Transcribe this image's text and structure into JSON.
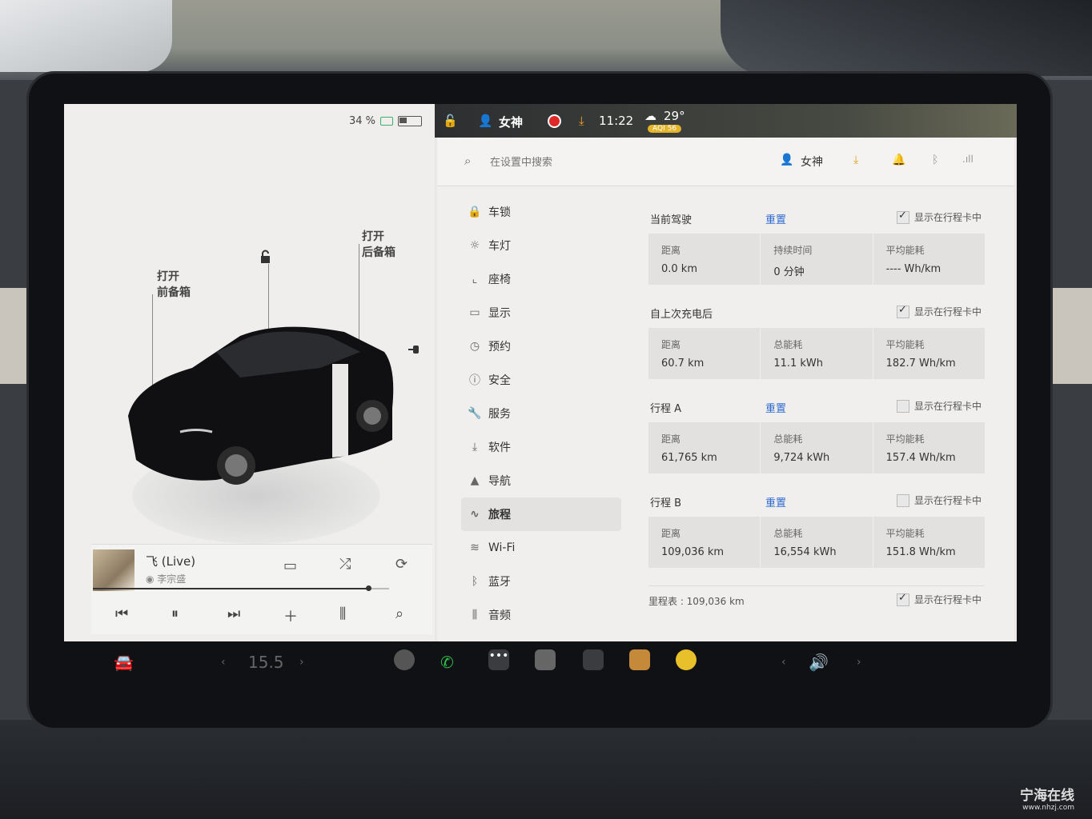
{
  "status_bar": {
    "battery_percent": "34 %",
    "user": "女神",
    "time": "11:22",
    "temperature": "29°",
    "aqi": "AQI 56"
  },
  "vehicle": {
    "frunk_label_line1": "打开",
    "frunk_label_line2": "前备箱",
    "trunk_label_line1": "打开",
    "trunk_label_line2": "后备箱"
  },
  "media": {
    "title": "飞 (Live)",
    "artist": "李宗盛",
    "progress": 0.93
  },
  "settings": {
    "search_placeholder": "在设置中搜索",
    "header_user": "女神",
    "nav": [
      {
        "label": "车锁",
        "icon": "lock-icon"
      },
      {
        "label": "车灯",
        "icon": "light-icon"
      },
      {
        "label": "座椅",
        "icon": "seat-icon"
      },
      {
        "label": "显示",
        "icon": "display-icon"
      },
      {
        "label": "预约",
        "icon": "schedule-icon"
      },
      {
        "label": "安全",
        "icon": "safety-icon"
      },
      {
        "label": "服务",
        "icon": "wrench-icon"
      },
      {
        "label": "软件",
        "icon": "download-icon"
      },
      {
        "label": "导航",
        "icon": "navigation-icon"
      },
      {
        "label": "旅程",
        "icon": "trips-icon"
      },
      {
        "label": "Wi-Fi",
        "icon": "wifi-icon"
      },
      {
        "label": "蓝牙",
        "icon": "bluetooth-icon"
      },
      {
        "label": "音频",
        "icon": "audio-icon"
      }
    ],
    "active_nav": "旅程",
    "reset_label": "重置",
    "show_in_card_label": "显示在行程卡中",
    "sections": [
      {
        "title": "当前驾驶",
        "has_reset": true,
        "checked": true,
        "stats": [
          {
            "k": "距离",
            "v": "0.0 km"
          },
          {
            "k": "持续时间",
            "v": "0 分钟"
          },
          {
            "k": "平均能耗",
            "v": "---- Wh/km"
          }
        ]
      },
      {
        "title": "自上次充电后",
        "has_reset": false,
        "checked": true,
        "stats": [
          {
            "k": "距离",
            "v": "60.7 km"
          },
          {
            "k": "总能耗",
            "v": "11.1 kWh"
          },
          {
            "k": "平均能耗",
            "v": "182.7 Wh/km"
          }
        ]
      },
      {
        "title": "行程 A",
        "has_reset": true,
        "checked": false,
        "stats": [
          {
            "k": "距离",
            "v": "61,765 km"
          },
          {
            "k": "总能耗",
            "v": "9,724 kWh"
          },
          {
            "k": "平均能耗",
            "v": "157.4 Wh/km"
          }
        ]
      },
      {
        "title": "行程 B",
        "has_reset": true,
        "checked": false,
        "stats": [
          {
            "k": "距离",
            "v": "109,036 km"
          },
          {
            "k": "总能耗",
            "v": "16,554 kWh"
          },
          {
            "k": "平均能耗",
            "v": "151.8 Wh/km"
          }
        ]
      }
    ],
    "odometer": "里程表 : 109,036 km",
    "odometer_checked": true
  },
  "dock": {
    "temp_value": "15.5"
  },
  "watermark": {
    "title": "宁海在线",
    "url": "www.nhzj.com"
  }
}
